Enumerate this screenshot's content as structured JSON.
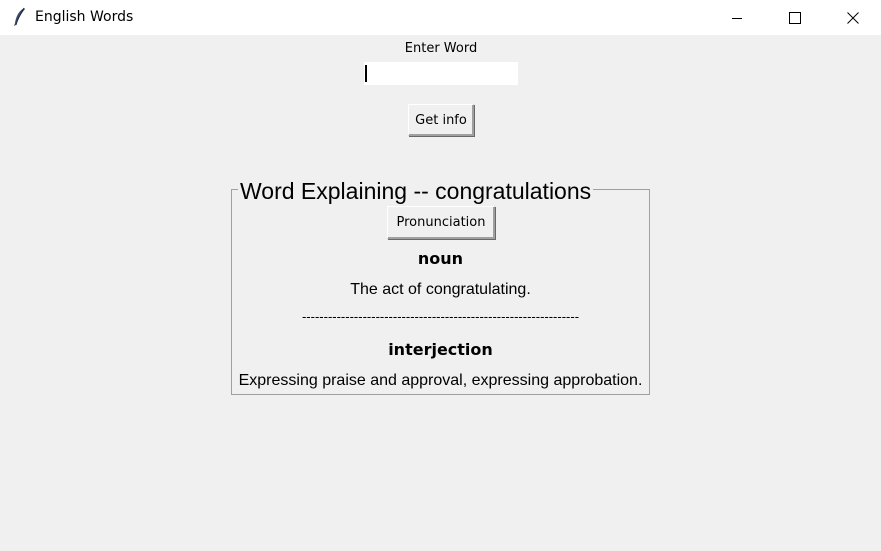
{
  "window": {
    "title": "English Words",
    "app_icon": "feather-icon",
    "controls": [
      "minimize-icon",
      "maximize-icon",
      "close-icon"
    ]
  },
  "form": {
    "label": "Enter Word",
    "input_value": "",
    "button_label": "Get info"
  },
  "result": {
    "frame_title": "Word Explaining -- congratulations",
    "pronunciation_label": "Pronunciation",
    "meanings": [
      {
        "part_of_speech": "noun",
        "definition": "The act of congratulating."
      },
      {
        "part_of_speech": "interjection",
        "definition": "Expressing praise and approval, expressing approbation."
      }
    ],
    "separator": "----------------------------------------------------------------"
  }
}
